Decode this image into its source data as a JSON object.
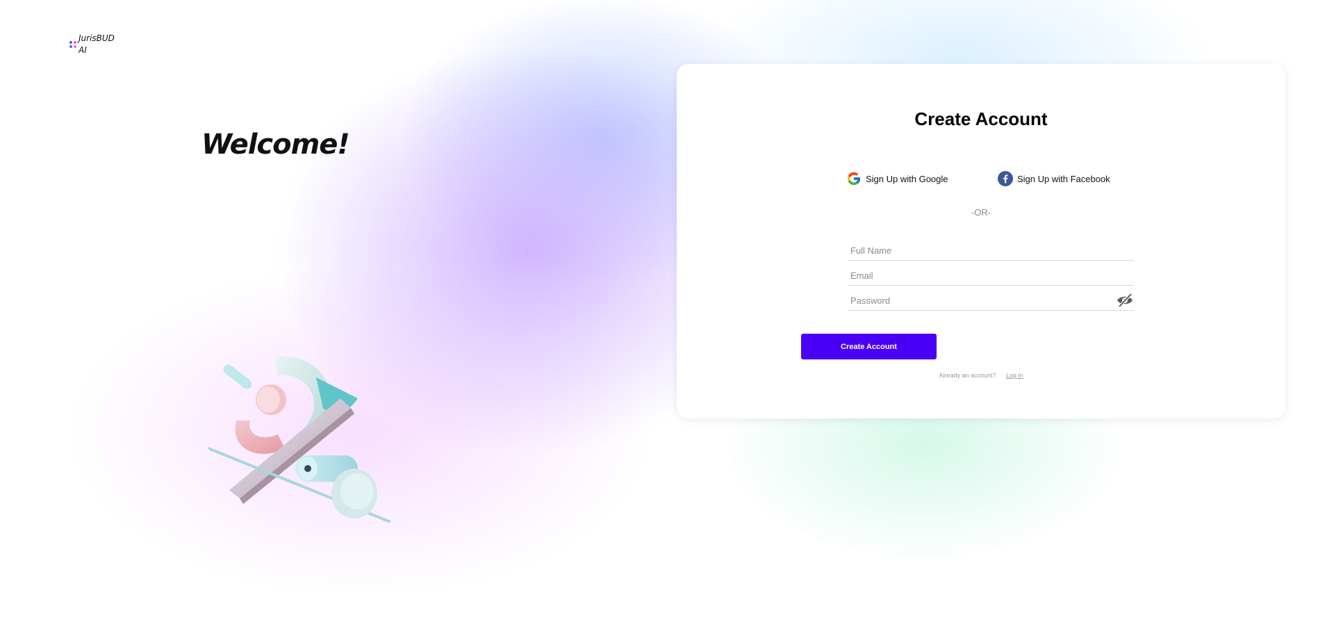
{
  "brand": {
    "name_line1": "JurisBUD",
    "name_line2": "AI",
    "icon": "grid-dots-icon",
    "dot_colors": [
      "#7b3ff2",
      "#c36cf0",
      "#4a6cf7",
      "#ff6fb1"
    ]
  },
  "hero": {
    "welcome": "Welcome!"
  },
  "form": {
    "title": "Create Account",
    "google_label": "Sign Up with Google",
    "facebook_label": "Sign Up with Facebook",
    "or_text": "-OR-",
    "full_name_placeholder": "Full Name",
    "email_placeholder": "Email",
    "password_placeholder": "Password",
    "password_toggle_icon": "eye-slash-icon",
    "submit_label": "Create Account",
    "login_prompt": "Already an account?",
    "login_link": "Log in"
  },
  "colors": {
    "accent": "#4a00f5",
    "facebook": "#3b5998"
  }
}
